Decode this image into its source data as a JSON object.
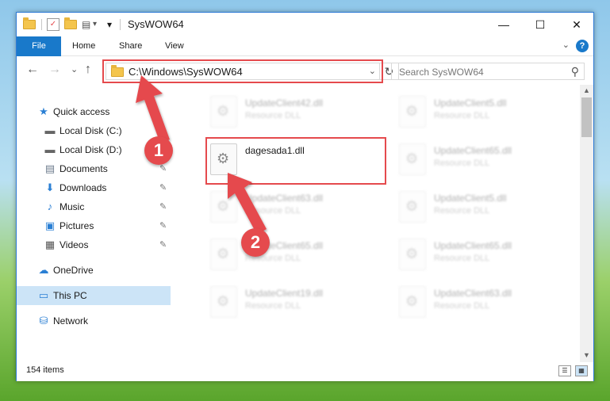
{
  "window": {
    "title": "SysWOW64",
    "quick_access_dropdown": "▾",
    "minimize": "—",
    "maximize": "☐",
    "close": "✕"
  },
  "ribbon": {
    "tabs": [
      {
        "label": "File"
      },
      {
        "label": "Home"
      },
      {
        "label": "Share"
      },
      {
        "label": "View"
      }
    ],
    "help": "?",
    "expand": "⌄"
  },
  "navbar": {
    "back": "←",
    "forward": "→",
    "recent": "⌄",
    "up": "↑",
    "address": "C:\\Windows\\SysWOW64",
    "address_dropdown": "⌄",
    "refresh": "↻",
    "search_placeholder": "Search SysWOW64",
    "search_icon": "⚲"
  },
  "sidebar": {
    "items": [
      {
        "label": "Quick access",
        "icon": "star-icon",
        "glyph": "★",
        "pinned": false
      },
      {
        "label": "Local Disk (C:)",
        "icon": "drive-icon",
        "glyph": "▬",
        "pinned": true
      },
      {
        "label": "Local Disk (D:)",
        "icon": "drive-icon",
        "glyph": "▬",
        "pinned": true
      },
      {
        "label": "Documents",
        "icon": "documents-icon",
        "glyph": "▤",
        "pinned": true
      },
      {
        "label": "Downloads",
        "icon": "download-icon",
        "glyph": "⬇",
        "pinned": true
      },
      {
        "label": "Music",
        "icon": "music-icon",
        "glyph": "♪",
        "pinned": true
      },
      {
        "label": "Pictures",
        "icon": "pictures-icon",
        "glyph": "▣",
        "pinned": true
      },
      {
        "label": "Videos",
        "icon": "video-icon",
        "glyph": "▦",
        "pinned": true
      },
      {
        "label": "OneDrive",
        "icon": "cloud-icon",
        "glyph": "☁",
        "pinned": false
      },
      {
        "label": "This PC",
        "icon": "computer-icon",
        "glyph": "▭",
        "pinned": false
      },
      {
        "label": "Network",
        "icon": "network-icon",
        "glyph": "⛁",
        "pinned": false
      }
    ],
    "pin_glyph": "✎"
  },
  "files": [
    {
      "name": "UpdateClient42.dll",
      "type": "Resource DLL",
      "blurred": true
    },
    {
      "name": "UpdateClient5.dll",
      "type": "Resource DLL",
      "blurred": true
    },
    {
      "name": "dagesada1.dll",
      "type": "",
      "blurred": false
    },
    {
      "name": "UpdateClient65.dll",
      "type": "Resource DLL",
      "blurred": true
    },
    {
      "name": "UpdateClient63.dll",
      "type": "Resource DLL",
      "blurred": true
    },
    {
      "name": "UpdateClient5.dll",
      "type": "Resource DLL",
      "blurred": true
    },
    {
      "name": "UpdateClient65.dll",
      "type": "Resource DLL",
      "blurred": true
    },
    {
      "name": "UpdateClient65.dll",
      "type": "Resource DLL",
      "blurred": true
    },
    {
      "name": "UpdateClient19.dll",
      "type": "Resource DLL",
      "blurred": true
    },
    {
      "name": "UpdateClient63.dll",
      "type": "Resource DLL",
      "blurred": true
    }
  ],
  "gear_glyph": "⚙",
  "status": {
    "item_count": "154 items",
    "details_view": "☰",
    "icons_view": "▦"
  },
  "annotations": {
    "marker1": "1",
    "marker2": "2",
    "color": "#e54a4d"
  },
  "scroll": {
    "up": "▲",
    "down": "▼"
  }
}
